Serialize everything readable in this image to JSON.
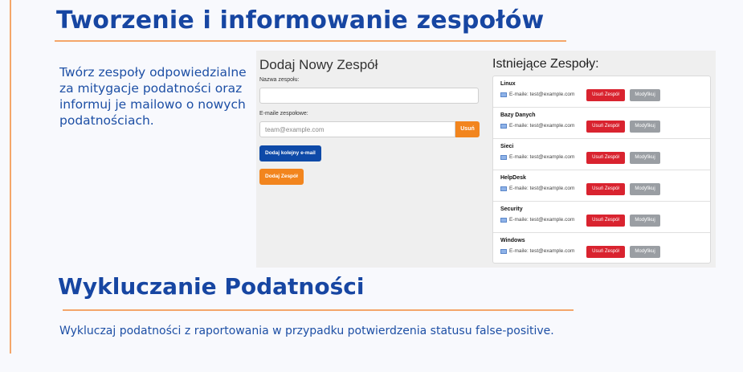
{
  "slide": {
    "heading1": "Tworzenie i informowanie zespołów",
    "description1": "Twórz zespoły odpowiedzialne za mitygacje podatności oraz informuj je mailowo o nowych podatnościach.",
    "heading2": "Wykluczanie Podatności",
    "description2": "Wykluczaj podatności z raportowania w przypadku potwierdzenia statusu false-positive."
  },
  "form": {
    "title": "Dodaj Nowy Zespół",
    "team_name_label": "Nazwa zespołu:",
    "team_name_value": "",
    "emails_label": "E-maile zespołowe:",
    "email_placeholder": "team@example.com",
    "remove_email_label": "Usuń",
    "add_email_label": "Dodaj kolejny e-mail",
    "add_team_label": "Dodaj Zespół"
  },
  "teams": {
    "title": "Istniejące Zespoły:",
    "email_prefix": "E-maile:",
    "delete_label": "Usuń Zespół",
    "edit_label": "Modyfikuj",
    "items": [
      {
        "name": "Linux",
        "email": "test@example.com"
      },
      {
        "name": "Bazy Danych",
        "email": "test@example.com"
      },
      {
        "name": "Sieci",
        "email": "test@example.com"
      },
      {
        "name": "HelpDesk",
        "email": "test@example.com"
      },
      {
        "name": "Security",
        "email": "test@example.com"
      },
      {
        "name": "Windows",
        "email": "test@example.com"
      }
    ]
  },
  "colors": {
    "heading": "#1746a2",
    "accent_line": "#f4a66a",
    "primary_button": "#0e4aa8",
    "orange_button": "#f2851e",
    "danger_button": "#d9232f",
    "secondary_button": "#9a9ea3"
  }
}
